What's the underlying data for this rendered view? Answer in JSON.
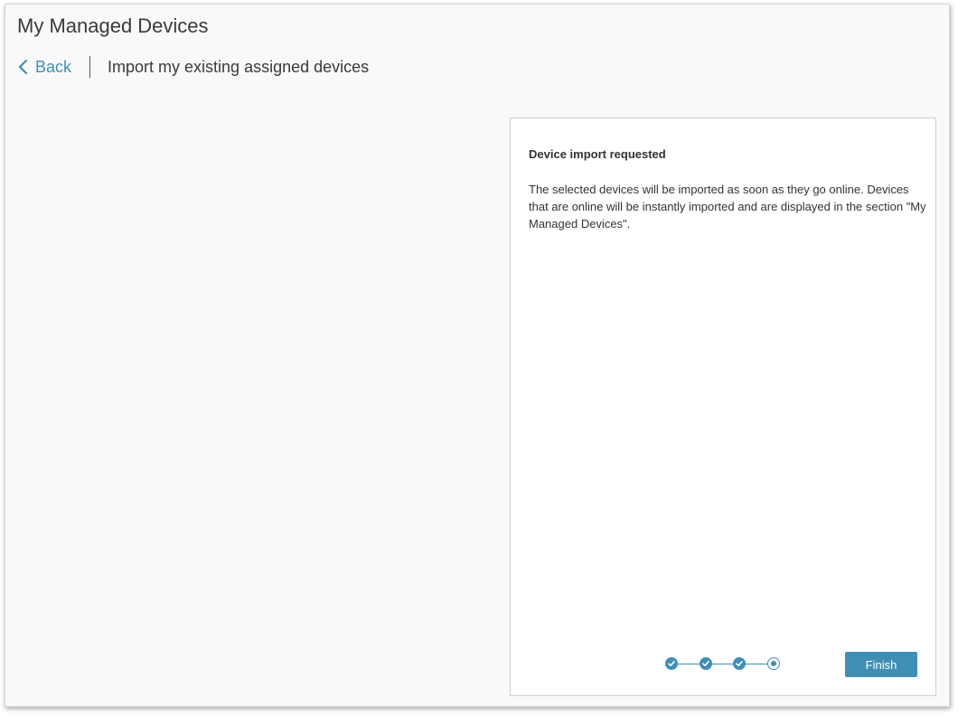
{
  "header": {
    "title": "My Managed Devices"
  },
  "nav": {
    "back_label": "Back",
    "subtitle": "Import my existing assigned devices"
  },
  "panel": {
    "heading": "Device import requested",
    "body": "The selected devices will be imported as soon as they go online. Devices that are online will be instantly imported and are displayed in the section \"My Managed Devices\".",
    "finish_label": "Finish",
    "steps": {
      "total": 4,
      "completed": 3,
      "current": 4
    }
  },
  "colors": {
    "accent": "#3f8fb5",
    "text": "#333333",
    "background": "#f9f9f9",
    "panel_background": "#ffffff"
  },
  "icons": {
    "back": "chevron-left-icon",
    "step_done": "check-icon",
    "step_current": "dot-icon"
  }
}
